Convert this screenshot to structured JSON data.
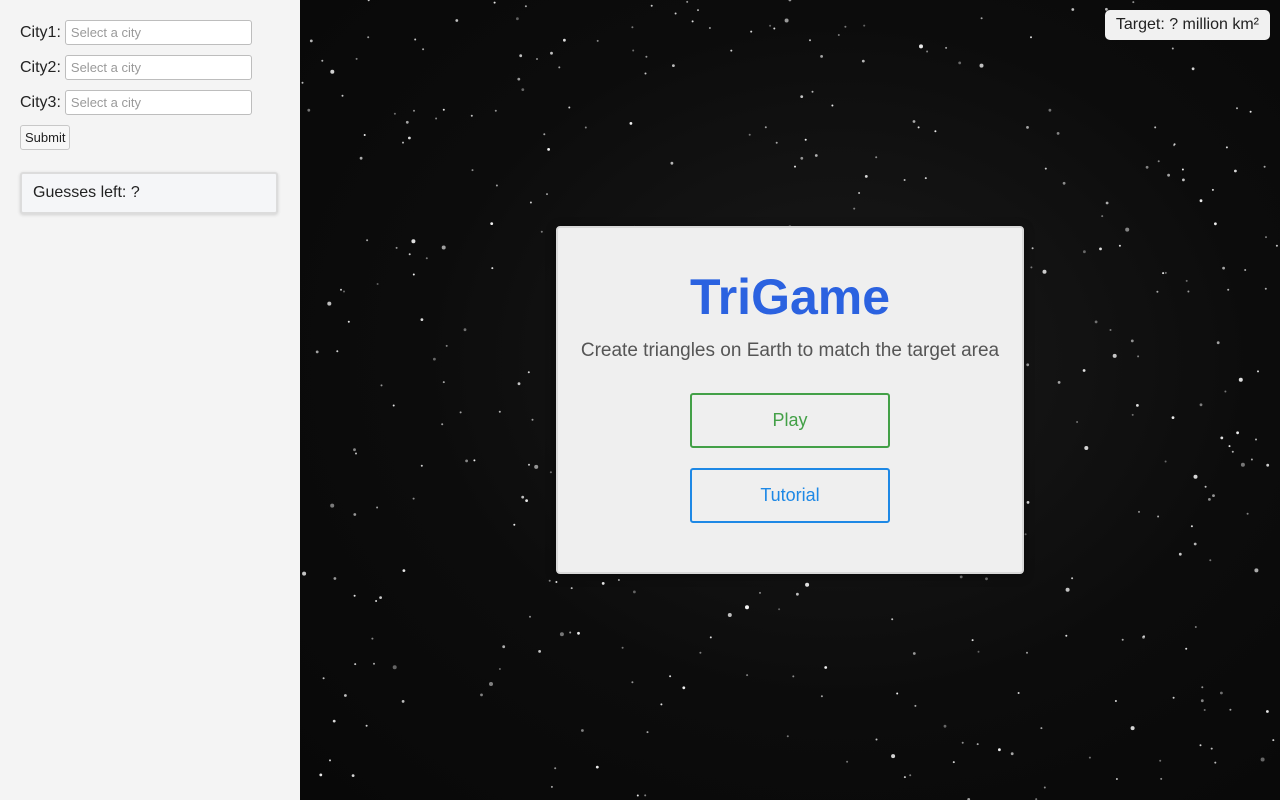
{
  "sidebar": {
    "cities": [
      {
        "label": "City1:",
        "placeholder": "Select a city",
        "value": ""
      },
      {
        "label": "City2:",
        "placeholder": "Select a city",
        "value": ""
      },
      {
        "label": "City3:",
        "placeholder": "Select a city",
        "value": ""
      }
    ],
    "submit_label": "Submit",
    "guesses_text": "Guesses left: ?"
  },
  "target": {
    "text": "Target: ? million km²"
  },
  "menu": {
    "title": "TriGame",
    "subtitle": "Create triangles on Earth to match the target area",
    "play_label": "Play",
    "tutorial_label": "Tutorial"
  },
  "colors": {
    "title": "#2b62e0",
    "play": "#43a047",
    "tutorial": "#1e88e5",
    "sidebar_bg": "#f4f4f4",
    "space_bg": "#0c0c0c"
  }
}
